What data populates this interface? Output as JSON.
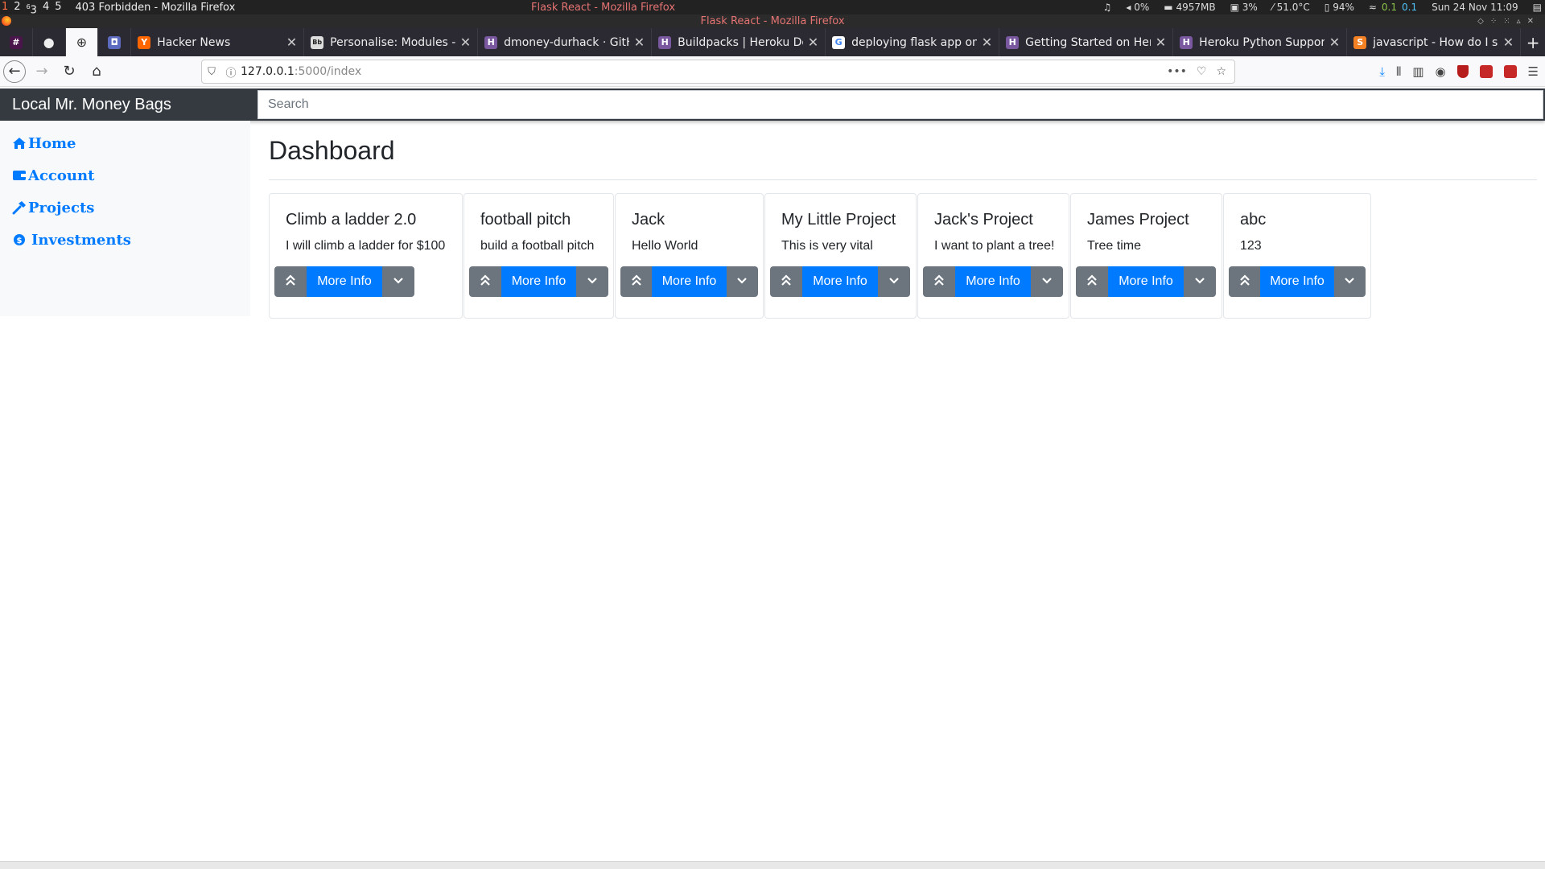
{
  "system": {
    "workspaces": [
      "1",
      "2",
      "3",
      "4",
      "5"
    ],
    "workspace_superscripts": [
      "",
      "",
      "6",
      "",
      ""
    ],
    "window_title": "403 Forbidden - Mozilla Firefox",
    "center_title": "Flask React - Mozilla Firefox",
    "volume": "0%",
    "memory": "4957MB",
    "cpu": "3%",
    "temperature": "51.0°C",
    "battery": "94%",
    "net_up": "0.1",
    "net_down": "0.1",
    "datetime": "Sun 24 Nov 11:09"
  },
  "browser": {
    "title": "Flask React - Mozilla Firefox",
    "tabs": [
      {
        "label": "Hacker News",
        "fav_color": "#ff6600",
        "fav_char": "Y"
      },
      {
        "label": "Personalise: Modules -",
        "fav_color": "#444444",
        "fav_char": "Bb"
      },
      {
        "label": "dmoney-durhack · GitH",
        "fav_color": "#79589f",
        "fav_char": "H"
      },
      {
        "label": "Buildpacks | Heroku De",
        "fav_color": "#79589f",
        "fav_char": "H"
      },
      {
        "label": "deploying flask app on",
        "fav_color": "#ffffff",
        "fav_char": "G"
      },
      {
        "label": "Getting Started on Hero",
        "fav_color": "#79589f",
        "fav_char": "H"
      },
      {
        "label": "Heroku Python Support",
        "fav_color": "#79589f",
        "fav_char": "H"
      },
      {
        "label": "javascript - How do I se",
        "fav_color": "#f48024",
        "fav_char": "S"
      }
    ],
    "url_host": "127.0.0.1",
    "url_path": ":5000/index"
  },
  "app": {
    "brand": "Local Mr. Money Bags",
    "search_placeholder": "Search",
    "sidebar": [
      {
        "label": "Home",
        "icon": "home-icon"
      },
      {
        "label": "Account",
        "icon": "wallet-icon"
      },
      {
        "label": "Projects",
        "icon": "hammer-icon"
      },
      {
        "label": "Investments",
        "icon": "dollar-icon"
      }
    ],
    "page_title": "Dashboard",
    "more_info_label": "More Info",
    "projects": [
      {
        "title": "Climb a ladder 2.0",
        "desc": "I will climb a ladder for $100"
      },
      {
        "title": "football pitch",
        "desc": "build a football pitch"
      },
      {
        "title": "Jack",
        "desc": "Hello World"
      },
      {
        "title": "My Little Project",
        "desc": "This is very vital"
      },
      {
        "title": "Jack's Project",
        "desc": "I want to plant a tree!"
      },
      {
        "title": "James Project",
        "desc": "Tree time"
      },
      {
        "title": "abc",
        "desc": "123"
      }
    ],
    "colors": {
      "primary": "#007bff",
      "secondary": "#6c757d",
      "header": "#343a40"
    }
  }
}
